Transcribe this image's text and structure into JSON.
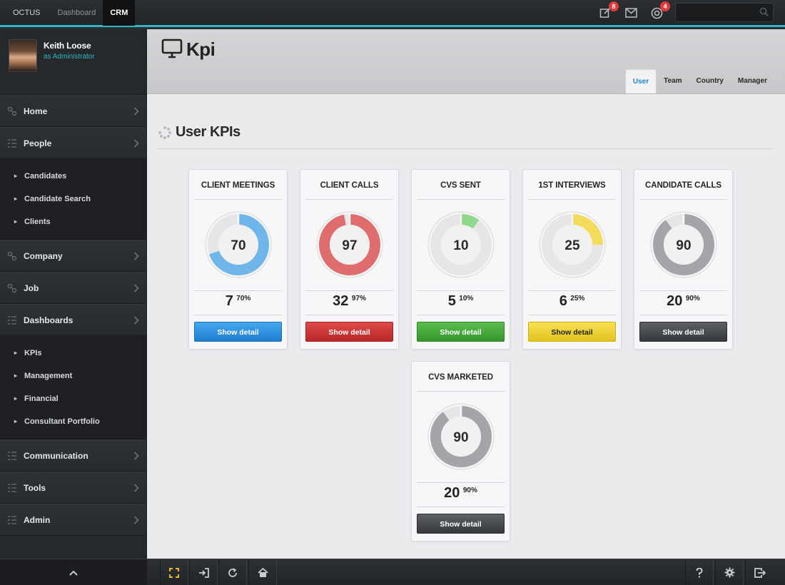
{
  "topbar": {
    "brand": "OCTUS",
    "nav": [
      {
        "label": "Dashboard"
      },
      {
        "label": "CRM",
        "active": true
      }
    ],
    "notifications": {
      "edit_count": "8",
      "mail_icon": "mail-icon",
      "support_count": "4"
    },
    "search": {
      "value": "",
      "placeholder": ""
    }
  },
  "user": {
    "name": "Keith Loose",
    "role": "as Administrator"
  },
  "sidebar": {
    "items": [
      {
        "label": "Home"
      },
      {
        "label": "People",
        "children": [
          "Candidates",
          "Candidate Search",
          "Clients"
        ]
      },
      {
        "label": "Company"
      },
      {
        "label": "Job"
      },
      {
        "label": "Dashboards",
        "children": [
          "KPIs",
          "Management",
          "Financial",
          "Consultant Portfolio"
        ]
      },
      {
        "label": "Communication"
      },
      {
        "label": "Tools"
      },
      {
        "label": "Admin"
      }
    ]
  },
  "page": {
    "title": "Kpi",
    "tabs": [
      "User",
      "Team",
      "Country",
      "Manager"
    ],
    "active_tab": "User",
    "section_title": "User KPIs"
  },
  "kpis": [
    {
      "title": "CLIENT MEETINGS",
      "center": "70",
      "count": "7",
      "percent": "70%",
      "fraction": 0.7,
      "color": "#6fb6ea",
      "button": "Show detail"
    },
    {
      "title": "CLIENT CALLS",
      "center": "97",
      "count": "32",
      "percent": "97%",
      "fraction": 0.97,
      "color": "#e06d6d",
      "button": "Show detail"
    },
    {
      "title": "CVS SENT",
      "center": "10",
      "count": "5",
      "percent": "10%",
      "fraction": 0.1,
      "color": "#8fd88c",
      "button": "Show detail"
    },
    {
      "title": "1ST INTERVIEWS",
      "center": "25",
      "count": "6",
      "percent": "25%",
      "fraction": 0.25,
      "color": "#f3dc5b",
      "button": "Show detail"
    },
    {
      "title": "CANDIDATE CALLS",
      "center": "90",
      "count": "20",
      "percent": "90%",
      "fraction": 0.9,
      "color": "#a3a5a8",
      "button": "Show detail"
    },
    {
      "title": "CVS MARKETED",
      "center": "90",
      "count": "20",
      "percent": "90%",
      "fraction": 0.9,
      "color": "#a3a5a8",
      "button": "Show detail"
    }
  ]
}
